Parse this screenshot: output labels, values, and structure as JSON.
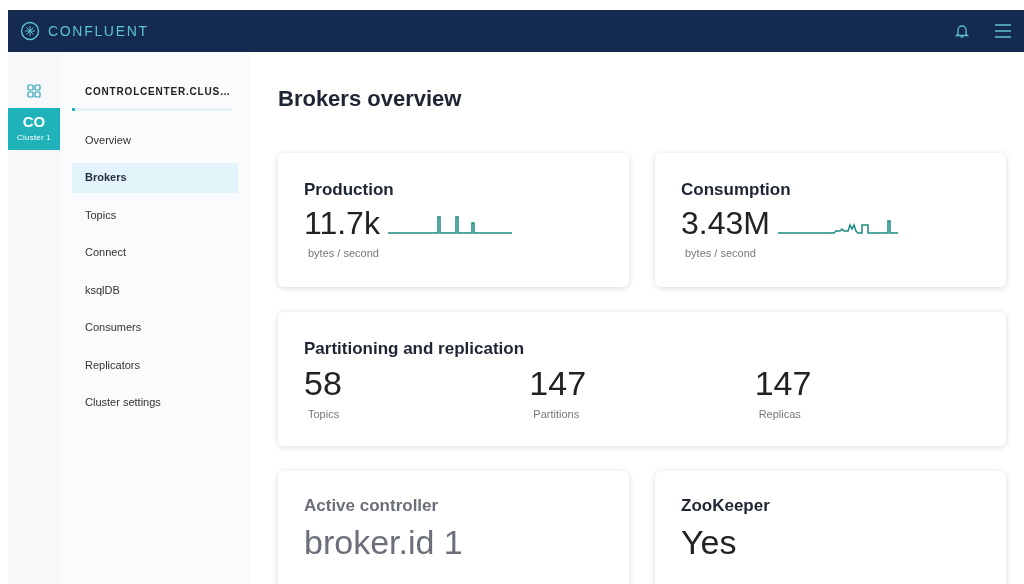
{
  "header": {
    "brand": "CONFLUENT"
  },
  "rail": {
    "cluster_initials": "CO",
    "cluster_name": "Cluster 1",
    "selected": true
  },
  "sidebar": {
    "cluster_title": "CONTROLCENTER.CLUS…",
    "items": [
      {
        "label": "Overview",
        "selected": false
      },
      {
        "label": "Brokers",
        "selected": true
      },
      {
        "label": "Topics",
        "selected": false
      },
      {
        "label": "Connect",
        "selected": false
      },
      {
        "label": "ksqlDB",
        "selected": false
      },
      {
        "label": "Consumers",
        "selected": false
      },
      {
        "label": "Replicators",
        "selected": false
      },
      {
        "label": "Cluster settings",
        "selected": false
      }
    ]
  },
  "page": {
    "title": "Brokers overview"
  },
  "throughput_cards": [
    {
      "title": "Production",
      "value": "11.7k",
      "unit": "bytes / second",
      "kind": "sparkline"
    },
    {
      "title": "Consumption",
      "value": "3.43M",
      "unit": "bytes / second",
      "kind": "sparkline"
    }
  ],
  "partitioning": {
    "title": "Partitioning and replication",
    "stats": [
      {
        "value": "58",
        "label": "Topics"
      },
      {
        "value": "147",
        "label": "Partitions"
      },
      {
        "value": "147",
        "label": "Replicas"
      }
    ]
  },
  "status_cards": [
    {
      "title": "Active controller",
      "value": "broker.id 1",
      "dimmed": true
    },
    {
      "title": "ZooKeeper",
      "value": "Yes",
      "dimmed": false
    }
  ]
}
